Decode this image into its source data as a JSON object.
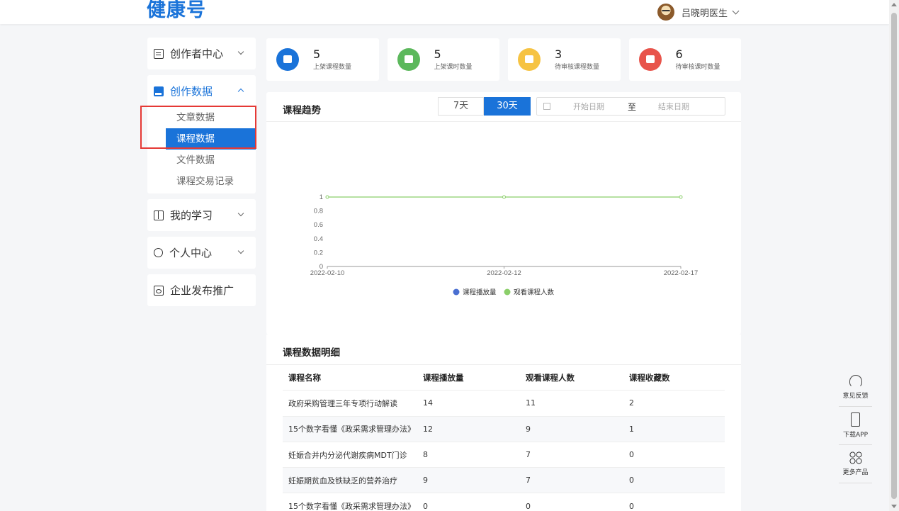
{
  "header": {
    "brand": "健康号",
    "user_name": "吕晓明医生"
  },
  "sidebar": {
    "groups": [
      {
        "label": "创作者中心",
        "icon": "document-icon",
        "active": false
      },
      {
        "label": "创作数据",
        "icon": "data-icon",
        "active": true,
        "items": [
          "文章数据",
          "课程数据",
          "文件数据",
          "课程交易记录"
        ],
        "selected_index": 1
      },
      {
        "label": "我的学习",
        "icon": "book-icon",
        "active": false
      },
      {
        "label": "个人中心",
        "icon": "person-icon",
        "active": false
      },
      {
        "label": "企业发布推广",
        "icon": "picture-icon",
        "active": false
      }
    ]
  },
  "stats": [
    {
      "value": "5",
      "label": "上架课程数量",
      "color": "#1a73d9",
      "icon": "book-icon"
    },
    {
      "value": "5",
      "label": "上架课时数量",
      "color": "#5cb85c",
      "icon": "calendar-icon"
    },
    {
      "value": "3",
      "label": "待审核课程数量",
      "color": "#f6c343",
      "icon": "review-icon"
    },
    {
      "value": "6",
      "label": "待审核课时数量",
      "color": "#e8544b",
      "icon": "review-icon"
    }
  ],
  "trend": {
    "title": "课程趋势",
    "range_7": "7天",
    "range_30": "30天",
    "range_selected": "30天",
    "start_placeholder": "开始日期",
    "to": "至",
    "end_placeholder": "结束日期"
  },
  "chart_data": {
    "type": "line",
    "x": [
      "2022-02-10",
      "2022-02-12",
      "2022-02-17"
    ],
    "series": [
      {
        "name": "课程播放量",
        "color": "#4a6fd1",
        "values": [
          null,
          null,
          null
        ]
      },
      {
        "name": "观看课程人数",
        "color": "#8bcf6a",
        "values": [
          1,
          1,
          1
        ]
      }
    ],
    "ylim": [
      0,
      1
    ],
    "yticks": [
      "0",
      "0.2",
      "0.4",
      "0.6",
      "0.8",
      "1"
    ],
    "legend": "bottom"
  },
  "detail": {
    "title": "课程数据明细",
    "columns": [
      "课程名称",
      "课程播放量",
      "观看课程人数",
      "课程收藏数"
    ],
    "rows": [
      [
        "政府采购管理三年专项行动解读",
        "14",
        "11",
        "2"
      ],
      [
        "15个数字看懂《政采需求管理办法》",
        "12",
        "9",
        "1"
      ],
      [
        "妊娠合并内分泌代谢疾病MDT门诊",
        "8",
        "7",
        "0"
      ],
      [
        "妊娠期贫血及铁缺乏的营养治疗",
        "9",
        "7",
        "0"
      ],
      [
        "15个数字看懂《政采需求管理办法》",
        "0",
        "0",
        "0"
      ]
    ]
  },
  "floatbar": {
    "feedback": "意见反馈",
    "download": "下载APP",
    "more": "更多产品"
  }
}
